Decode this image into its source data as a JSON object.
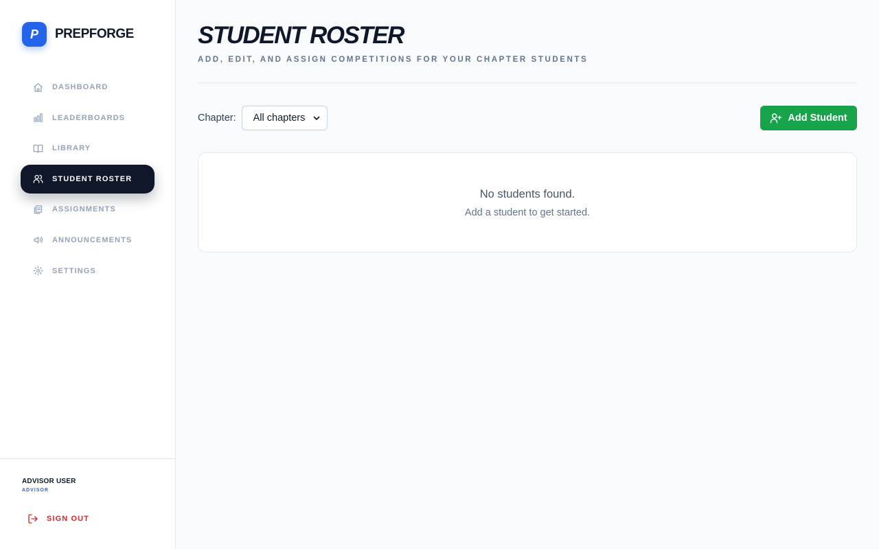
{
  "brand": {
    "logo_letter": "P",
    "name": "PREPFORGE",
    "accent": "#2563eb"
  },
  "sidebar": {
    "items": [
      {
        "label": "DASHBOARD",
        "icon": "home-icon",
        "active": false
      },
      {
        "label": "LEADERBOARDS",
        "icon": "bar-chart-icon",
        "active": false
      },
      {
        "label": "LIBRARY",
        "icon": "book-open-icon",
        "active": false
      },
      {
        "label": "STUDENT ROSTER",
        "icon": "users-icon",
        "active": true
      },
      {
        "label": "ASSIGNMENTS",
        "icon": "files-icon",
        "active": false
      },
      {
        "label": "ANNOUNCEMENTS",
        "icon": "megaphone-icon",
        "active": false
      },
      {
        "label": "SETTINGS",
        "icon": "gear-icon",
        "active": false
      }
    ],
    "user": {
      "name": "ADVISOR USER",
      "role": "ADVISOR"
    },
    "sign_out_label": "SIGN OUT"
  },
  "header": {
    "title": "STUDENT ROSTER",
    "subtitle": "ADD, EDIT, AND ASSIGN COMPETITIONS FOR YOUR CHAPTER STUDENTS"
  },
  "filters": {
    "chapter_label": "Chapter:",
    "chapter_selected": "All chapters"
  },
  "actions": {
    "add_student_label": "Add Student",
    "add_color": "#16a34a"
  },
  "empty_state": {
    "title": "No students found.",
    "subtitle": "Add a student to get started."
  },
  "colors": {
    "active_nav_bg": "#0f172a",
    "sign_out": "#dc2626",
    "page_bg": "#f8fafc"
  }
}
